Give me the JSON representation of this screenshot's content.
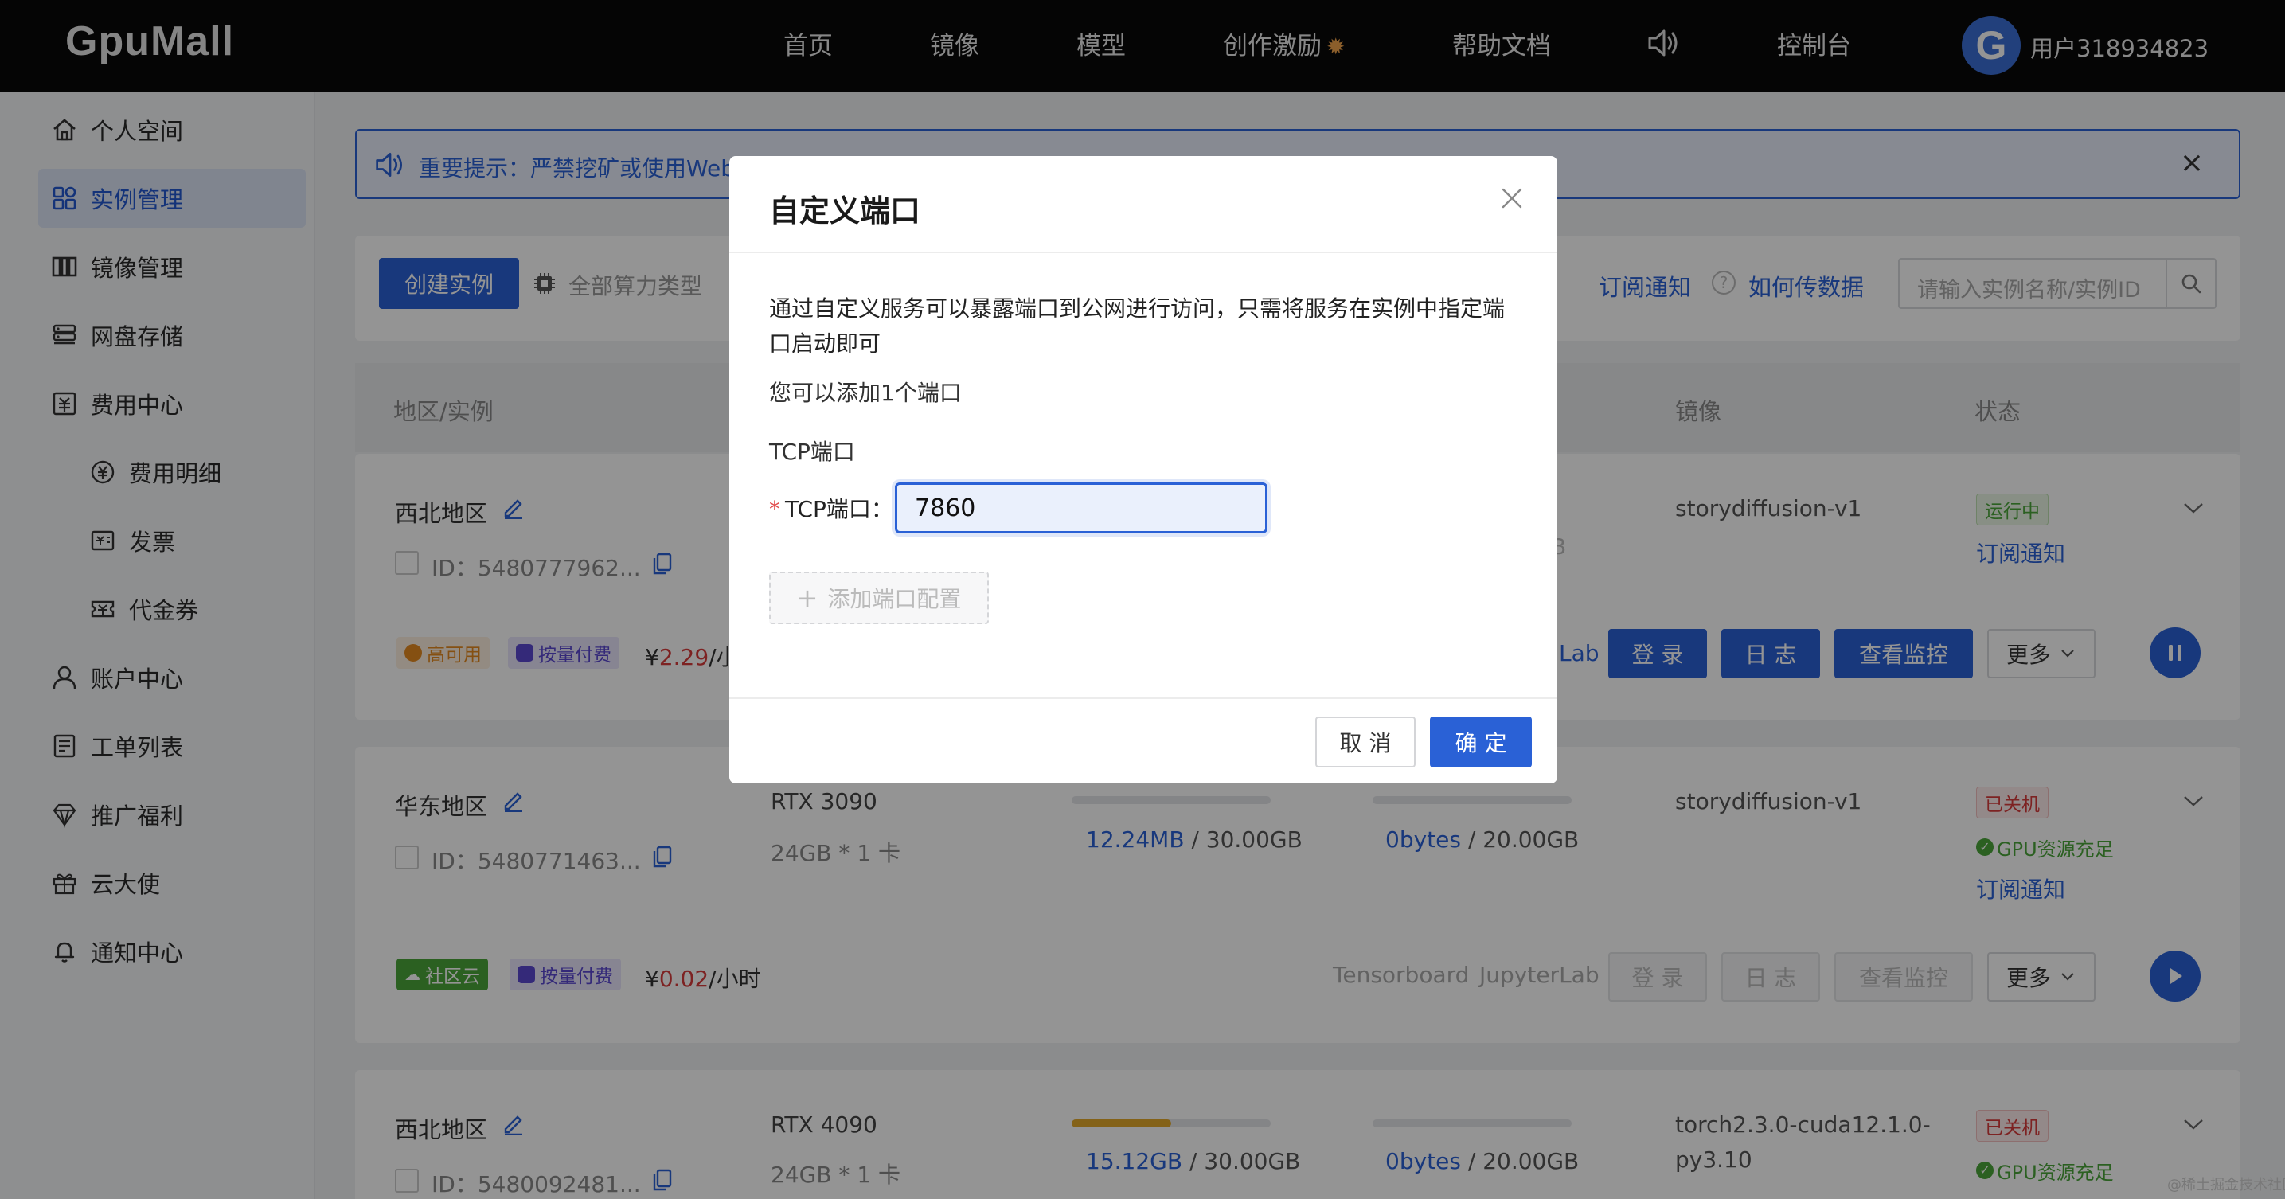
{
  "nav": {
    "logo": "GpuMall",
    "items": [
      "首页",
      "镜像",
      "模型",
      "创作激励",
      "帮助文档",
      "控制台"
    ],
    "fire": "✹",
    "avatar_letter": "G",
    "username": "用户318934823"
  },
  "sidebar": {
    "items": [
      "个人空间",
      "实例管理",
      "镜像管理",
      "网盘存储",
      "费用中心",
      "费用明细",
      "发票",
      "代金券",
      "账户中心",
      "工单列表",
      "推广福利",
      "云大使",
      "通知中心"
    ],
    "active": "实例管理"
  },
  "notice": {
    "text": "重要提示：严禁挖矿或使用Web",
    "close": "×"
  },
  "toolbar": {
    "create": "创建实例",
    "filter": "全部算力类型",
    "subscribe": "订阅通知",
    "help": "如何传数据",
    "search_placeholder": "请输入实例名称/实例ID"
  },
  "table": {
    "headers": [
      "地区/实例",
      "镜像",
      "状态"
    ]
  },
  "rows": [
    {
      "region": "西北地区",
      "id": "ID：5480777962...",
      "image": "storydiffusion-v1",
      "status": "运行中",
      "status_link": "订阅通知",
      "tags": [
        "高可用",
        "按量付费"
      ],
      "price_prefix": "¥",
      "price_value": "2.29",
      "price_unit": "/小",
      "lab_text": "Lab",
      "actions": [
        "登 录",
        "日 志",
        "查看监控",
        "更多"
      ],
      "bar_hint": "B"
    },
    {
      "region": "华东地区",
      "id": "ID：5480771463...",
      "gpu": "RTX 3090",
      "gpu_spec": "24GB * 1 卡",
      "disk_used": "12.24MB",
      "disk_total": " / 30.00GB",
      "net_used": "0bytes",
      "net_total": " / 20.00GB",
      "image": "storydiffusion-v1",
      "status": "已关机",
      "gpu_status": "GPU资源充足",
      "status_link": "订阅通知",
      "tags": [
        "社区云",
        "按量付费"
      ],
      "price_prefix": "¥",
      "price_value": "0.02",
      "price_unit": "/小时",
      "tensorboard": "Tensorboard",
      "jupyter": "JupyterLab",
      "actions": [
        "登 录",
        "日 志",
        "查看监控",
        "更多"
      ]
    },
    {
      "region": "西北地区",
      "id": "ID：5480092481...",
      "gpu": "RTX 4090",
      "gpu_spec": "24GB * 1 卡",
      "disk_used": "15.12GB",
      "disk_total": " / 30.00GB",
      "disk_fraction": 0.5,
      "net_used": "0bytes",
      "net_total": " / 20.00GB",
      "image_line1": "torch2.3.0-cuda12.1.0-",
      "image_line2": "py3.10",
      "status": "已关机",
      "gpu_status": "GPU资源充足"
    }
  ],
  "modal": {
    "title": "自定义端口",
    "desc": "通过自定义服务可以暴露端口到公网进行访问，只需将服务在实例中指定端口启动即可",
    "limit": "您可以添加1个端口",
    "section": "TCP端口",
    "required_mark": "*",
    "field_label": "TCP端口：",
    "port_value": "7860",
    "add_label": "添加端口配置",
    "cancel": "取 消",
    "ok": "确 定"
  },
  "watermark": "@稀土掘金技术社区",
  "colors": {
    "accent": "#2a61d6",
    "danger": "#d83b3b",
    "success": "#4aa53a"
  }
}
